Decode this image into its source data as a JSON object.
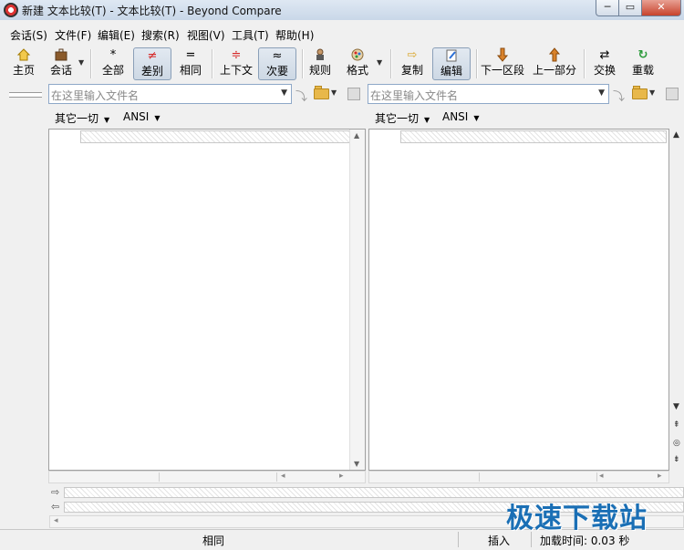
{
  "window": {
    "title": "新建 文本比较(T) - 文本比较(T) - Beyond Compare",
    "min": "─",
    "max": "▭",
    "close": "✕"
  },
  "menu": [
    "会话(S)",
    "文件(F)",
    "编辑(E)",
    "搜索(R)",
    "视图(V)",
    "工具(T)",
    "帮助(H)"
  ],
  "toolbar": {
    "home": {
      "label": "主页",
      "icon": "home-icon"
    },
    "session": {
      "label": "会话",
      "icon": "briefcase-icon"
    },
    "all": {
      "label": "全部",
      "glyph": "*"
    },
    "diff": {
      "label": "差别",
      "glyph": "≠"
    },
    "same": {
      "label": "相同",
      "glyph": "="
    },
    "context": {
      "label": "上下文",
      "glyph": "≑"
    },
    "minor": {
      "label": "次要",
      "glyph": "≈"
    },
    "rules": {
      "label": "规则",
      "icon": "rules-icon"
    },
    "format": {
      "label": "格式",
      "icon": "format-icon"
    },
    "copy": {
      "label": "复制",
      "glyph": "⇨"
    },
    "edit": {
      "label": "编辑",
      "icon": "edit-icon"
    },
    "next_section": {
      "label": "下一区段",
      "glyph": "🡇"
    },
    "prev_section": {
      "label": "上一部分",
      "glyph": "🡅"
    },
    "swap": {
      "label": "交换",
      "glyph": "⇄"
    },
    "reload": {
      "label": "重载",
      "glyph": "↻"
    }
  },
  "left": {
    "path_placeholder": "在这里输入文件名",
    "format_other": "其它一切",
    "encoding": "ANSI"
  },
  "right": {
    "path_placeholder": "在这里输入文件名",
    "format_other": "其它一切",
    "encoding": "ANSI"
  },
  "colors": {
    "diff_red": "#d62828",
    "accent_blue": "#1a6fb5",
    "reload_green": "#2a9a3a",
    "arrow_orange": "#d9822b"
  },
  "status": {
    "compare": "相同",
    "mode": "插入",
    "load_time": "加载时间: 0.03 秒"
  },
  "watermark": "极速下载站"
}
